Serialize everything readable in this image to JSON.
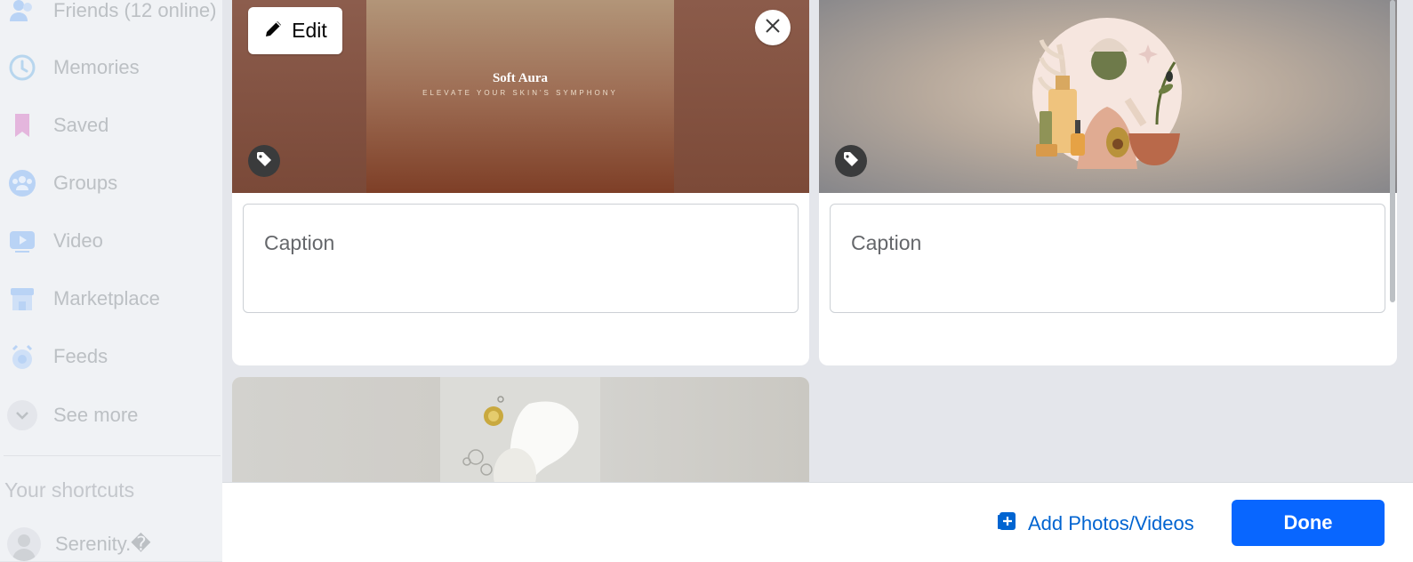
{
  "sidebar": {
    "items": [
      {
        "label": "Friends (12 online)",
        "icon": "friends-icon"
      },
      {
        "label": "Memories",
        "icon": "memories-clock-icon"
      },
      {
        "label": "Saved",
        "icon": "saved-bookmark-icon"
      },
      {
        "label": "Groups",
        "icon": "groups-icon"
      },
      {
        "label": "Video",
        "icon": "video-icon"
      },
      {
        "label": "Marketplace",
        "icon": "marketplace-store-icon"
      },
      {
        "label": "Feeds",
        "icon": "feeds-icon"
      },
      {
        "label": "See more",
        "icon": "chevron-down-icon"
      }
    ],
    "shortcuts_heading": "Your shortcuts",
    "shortcut_item": "Serenity.�"
  },
  "media": [
    {
      "caption_placeholder": "Caption",
      "edit_label": "Edit",
      "image_title": "Soft Aura",
      "image_subtitle": "ELEVATE YOUR SKIN'S SYMPHONY"
    },
    {
      "caption_placeholder": "Caption"
    }
  ],
  "footer": {
    "add_label": "Add Photos/Videos",
    "done_label": "Done"
  },
  "colors": {
    "accent": "#0866ff",
    "link": "#0064d1"
  }
}
